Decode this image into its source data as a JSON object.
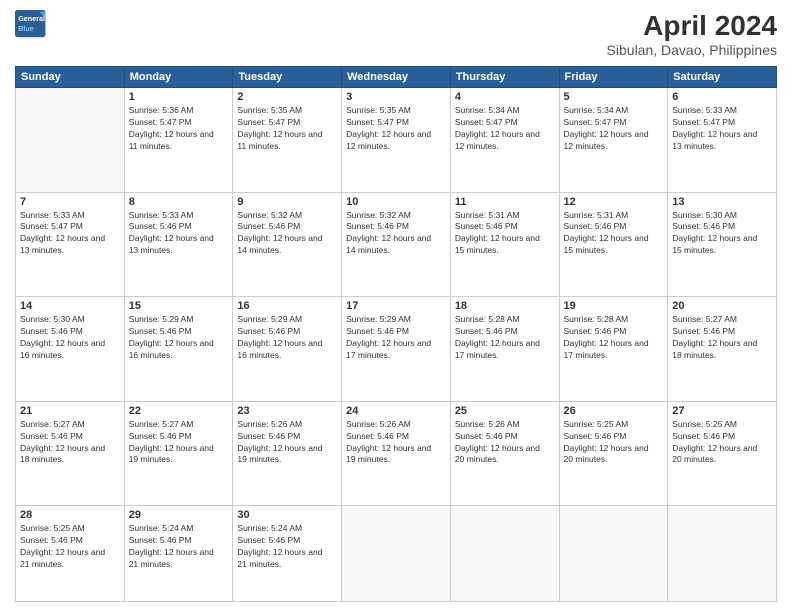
{
  "header": {
    "logo_line1": "General",
    "logo_line2": "Blue",
    "title": "April 2024",
    "location": "Sibulan, Davao, Philippines"
  },
  "days_of_week": [
    "Sunday",
    "Monday",
    "Tuesday",
    "Wednesday",
    "Thursday",
    "Friday",
    "Saturday"
  ],
  "weeks": [
    [
      {
        "day": "",
        "sunrise": "",
        "sunset": "",
        "daylight": ""
      },
      {
        "day": "1",
        "sunrise": "Sunrise: 5:36 AM",
        "sunset": "Sunset: 5:47 PM",
        "daylight": "Daylight: 12 hours and 11 minutes."
      },
      {
        "day": "2",
        "sunrise": "Sunrise: 5:35 AM",
        "sunset": "Sunset: 5:47 PM",
        "daylight": "Daylight: 12 hours and 11 minutes."
      },
      {
        "day": "3",
        "sunrise": "Sunrise: 5:35 AM",
        "sunset": "Sunset: 5:47 PM",
        "daylight": "Daylight: 12 hours and 12 minutes."
      },
      {
        "day": "4",
        "sunrise": "Sunrise: 5:34 AM",
        "sunset": "Sunset: 5:47 PM",
        "daylight": "Daylight: 12 hours and 12 minutes."
      },
      {
        "day": "5",
        "sunrise": "Sunrise: 5:34 AM",
        "sunset": "Sunset: 5:47 PM",
        "daylight": "Daylight: 12 hours and 12 minutes."
      },
      {
        "day": "6",
        "sunrise": "Sunrise: 5:33 AM",
        "sunset": "Sunset: 5:47 PM",
        "daylight": "Daylight: 12 hours and 13 minutes."
      }
    ],
    [
      {
        "day": "7",
        "sunrise": "Sunrise: 5:33 AM",
        "sunset": "Sunset: 5:47 PM",
        "daylight": "Daylight: 12 hours and 13 minutes."
      },
      {
        "day": "8",
        "sunrise": "Sunrise: 5:33 AM",
        "sunset": "Sunset: 5:46 PM",
        "daylight": "Daylight: 12 hours and 13 minutes."
      },
      {
        "day": "9",
        "sunrise": "Sunrise: 5:32 AM",
        "sunset": "Sunset: 5:46 PM",
        "daylight": "Daylight: 12 hours and 14 minutes."
      },
      {
        "day": "10",
        "sunrise": "Sunrise: 5:32 AM",
        "sunset": "Sunset: 5:46 PM",
        "daylight": "Daylight: 12 hours and 14 minutes."
      },
      {
        "day": "11",
        "sunrise": "Sunrise: 5:31 AM",
        "sunset": "Sunset: 5:46 PM",
        "daylight": "Daylight: 12 hours and 15 minutes."
      },
      {
        "day": "12",
        "sunrise": "Sunrise: 5:31 AM",
        "sunset": "Sunset: 5:46 PM",
        "daylight": "Daylight: 12 hours and 15 minutes."
      },
      {
        "day": "13",
        "sunrise": "Sunrise: 5:30 AM",
        "sunset": "Sunset: 5:46 PM",
        "daylight": "Daylight: 12 hours and 15 minutes."
      }
    ],
    [
      {
        "day": "14",
        "sunrise": "Sunrise: 5:30 AM",
        "sunset": "Sunset: 5:46 PM",
        "daylight": "Daylight: 12 hours and 16 minutes."
      },
      {
        "day": "15",
        "sunrise": "Sunrise: 5:29 AM",
        "sunset": "Sunset: 5:46 PM",
        "daylight": "Daylight: 12 hours and 16 minutes."
      },
      {
        "day": "16",
        "sunrise": "Sunrise: 5:29 AM",
        "sunset": "Sunset: 5:46 PM",
        "daylight": "Daylight: 12 hours and 16 minutes."
      },
      {
        "day": "17",
        "sunrise": "Sunrise: 5:29 AM",
        "sunset": "Sunset: 5:46 PM",
        "daylight": "Daylight: 12 hours and 17 minutes."
      },
      {
        "day": "18",
        "sunrise": "Sunrise: 5:28 AM",
        "sunset": "Sunset: 5:46 PM",
        "daylight": "Daylight: 12 hours and 17 minutes."
      },
      {
        "day": "19",
        "sunrise": "Sunrise: 5:28 AM",
        "sunset": "Sunset: 5:46 PM",
        "daylight": "Daylight: 12 hours and 17 minutes."
      },
      {
        "day": "20",
        "sunrise": "Sunrise: 5:27 AM",
        "sunset": "Sunset: 5:46 PM",
        "daylight": "Daylight: 12 hours and 18 minutes."
      }
    ],
    [
      {
        "day": "21",
        "sunrise": "Sunrise: 5:27 AM",
        "sunset": "Sunset: 5:46 PM",
        "daylight": "Daylight: 12 hours and 18 minutes."
      },
      {
        "day": "22",
        "sunrise": "Sunrise: 5:27 AM",
        "sunset": "Sunset: 5:46 PM",
        "daylight": "Daylight: 12 hours and 19 minutes."
      },
      {
        "day": "23",
        "sunrise": "Sunrise: 5:26 AM",
        "sunset": "Sunset: 5:46 PM",
        "daylight": "Daylight: 12 hours and 19 minutes."
      },
      {
        "day": "24",
        "sunrise": "Sunrise: 5:26 AM",
        "sunset": "Sunset: 5:46 PM",
        "daylight": "Daylight: 12 hours and 19 minutes."
      },
      {
        "day": "25",
        "sunrise": "Sunrise: 5:26 AM",
        "sunset": "Sunset: 5:46 PM",
        "daylight": "Daylight: 12 hours and 20 minutes."
      },
      {
        "day": "26",
        "sunrise": "Sunrise: 5:25 AM",
        "sunset": "Sunset: 5:46 PM",
        "daylight": "Daylight: 12 hours and 20 minutes."
      },
      {
        "day": "27",
        "sunrise": "Sunrise: 5:25 AM",
        "sunset": "Sunset: 5:46 PM",
        "daylight": "Daylight: 12 hours and 20 minutes."
      }
    ],
    [
      {
        "day": "28",
        "sunrise": "Sunrise: 5:25 AM",
        "sunset": "Sunset: 5:46 PM",
        "daylight": "Daylight: 12 hours and 21 minutes."
      },
      {
        "day": "29",
        "sunrise": "Sunrise: 5:24 AM",
        "sunset": "Sunset: 5:46 PM",
        "daylight": "Daylight: 12 hours and 21 minutes."
      },
      {
        "day": "30",
        "sunrise": "Sunrise: 5:24 AM",
        "sunset": "Sunset: 5:46 PM",
        "daylight": "Daylight: 12 hours and 21 minutes."
      },
      {
        "day": "",
        "sunrise": "",
        "sunset": "",
        "daylight": ""
      },
      {
        "day": "",
        "sunrise": "",
        "sunset": "",
        "daylight": ""
      },
      {
        "day": "",
        "sunrise": "",
        "sunset": "",
        "daylight": ""
      },
      {
        "day": "",
        "sunrise": "",
        "sunset": "",
        "daylight": ""
      }
    ]
  ]
}
